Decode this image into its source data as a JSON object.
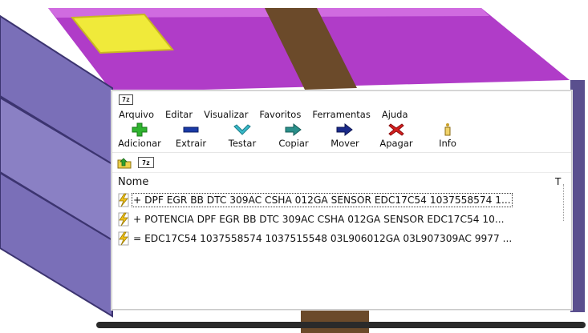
{
  "window": {
    "app_icon_text": "7z"
  },
  "menu": [
    "Arquivo",
    "Editar",
    "Visualizar",
    "Favoritos",
    "Ferramentas",
    "Ajuda"
  ],
  "toolbar": [
    {
      "label": "Adicionar",
      "icon": "plus-icon",
      "color": "#2fb32f"
    },
    {
      "label": "Extrair",
      "icon": "minus-icon",
      "color": "#1a3aa6"
    },
    {
      "label": "Testar",
      "icon": "check-icon",
      "color": "#37b8c8"
    },
    {
      "label": "Copiar",
      "icon": "copy-arrow-icon",
      "color": "#2a8f8a"
    },
    {
      "label": "Mover",
      "icon": "move-arrow-icon",
      "color": "#1a2a8a"
    },
    {
      "label": "Apagar",
      "icon": "delete-x-icon",
      "color": "#d41f1f"
    },
    {
      "label": "Info",
      "icon": "info-icon",
      "color": "#c9a12a"
    }
  ],
  "address": {
    "icon_text": "7z"
  },
  "columns": {
    "name": "Nome",
    "second_partial": "T"
  },
  "rows": [
    "+ DPF EGR BB DTC 309AC CSHA 012GA SENSOR EDC17C54 1037558574 1...",
    "+ POTENCIA DPF  EGR BB DTC 309AC CSHA 012GA SENSOR EDC17C54 10...",
    "=    EDC17C54 1037558574 1037515548 03L906012GA 03L907309AC 9977 ..."
  ],
  "colors": {
    "book_purple": "#b040c8",
    "book_spine": "#7a6fb0",
    "strap": "#6b4a2a",
    "label_yellow": "#f0ea3a"
  }
}
